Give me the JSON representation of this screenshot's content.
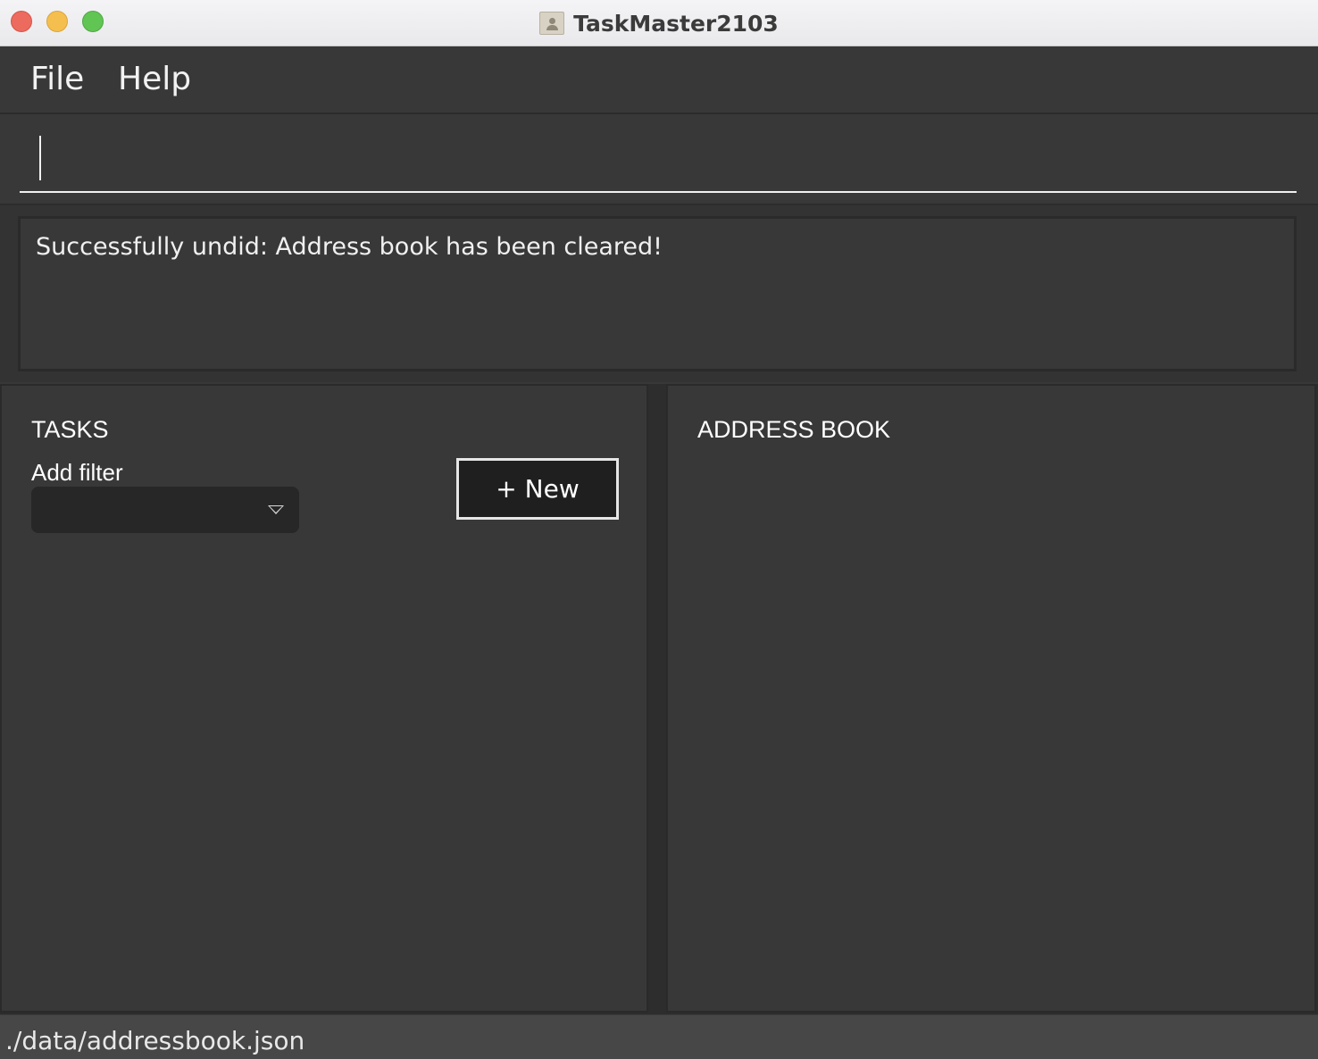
{
  "window": {
    "title": "TaskMaster2103"
  },
  "menu": {
    "items": [
      {
        "label": "File"
      },
      {
        "label": "Help"
      }
    ]
  },
  "command": {
    "value": ""
  },
  "result": {
    "message": "Successfully undid: Address book has been cleared!"
  },
  "tasks_panel": {
    "title": "TASKS",
    "filter_label": "Add filter",
    "filter_selected": "",
    "new_button_label": "+ New"
  },
  "address_panel": {
    "title": "ADDRESS BOOK"
  },
  "status": {
    "path": "./data/addressbook.json"
  },
  "colors": {
    "background": "#383838",
    "titlebar": "#ececee",
    "close": "#ed6a5e",
    "minimize": "#f5bf4f",
    "maximize": "#61c554"
  }
}
